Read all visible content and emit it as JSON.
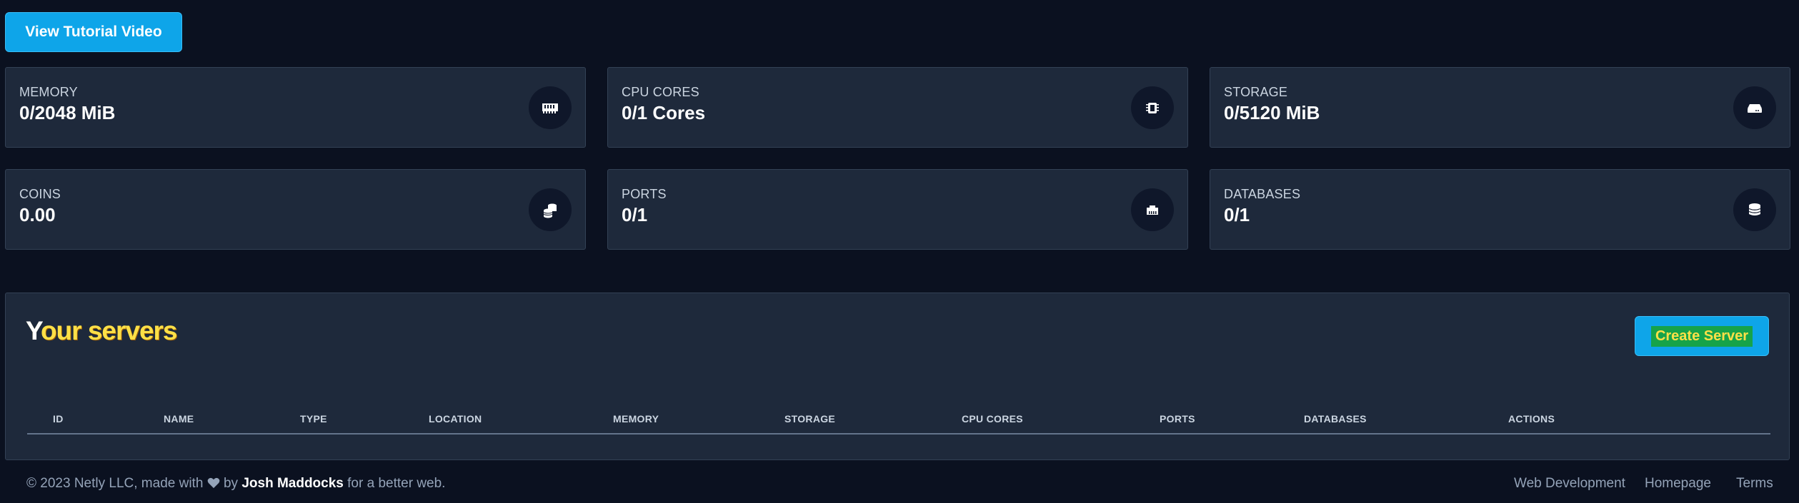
{
  "tutorial_button": {
    "label": "View Tutorial Video"
  },
  "stats": [
    {
      "label": "MEMORY",
      "value": "0/2048 MiB",
      "icon": "memory-icon"
    },
    {
      "label": "CPU CORES",
      "value": "0/1 Cores",
      "icon": "cpu-icon"
    },
    {
      "label": "STORAGE",
      "value": "0/5120 MiB",
      "icon": "hdd-icon"
    },
    {
      "label": "COINS",
      "value": "0.00",
      "icon": "coins-icon"
    },
    {
      "label": "PORTS",
      "value": "0/1",
      "icon": "ethernet-icon"
    },
    {
      "label": "DATABASES",
      "value": "0/1",
      "icon": "database-icon"
    }
  ],
  "servers": {
    "title": "Your servers",
    "create_button": "Create Server",
    "columns": [
      "ID",
      "NAME",
      "TYPE",
      "LOCATION",
      "MEMORY",
      "STORAGE",
      "CPU CORES",
      "PORTS",
      "DATABASES",
      "ACTIONS"
    ],
    "rows": []
  },
  "footer": {
    "copyright_prefix": "© 2023 Netly LLC, made with",
    "by": "by",
    "author": "Josh Maddocks",
    "suffix": "for a better web.",
    "links": [
      "Web Development",
      "Homepage",
      "Terms"
    ]
  },
  "colors": {
    "background": "#0b1120",
    "card": "#1e293b",
    "accent": "#0ea5e9",
    "highlight_yellow": "#fde047",
    "highlight_green": "#16a34a"
  }
}
